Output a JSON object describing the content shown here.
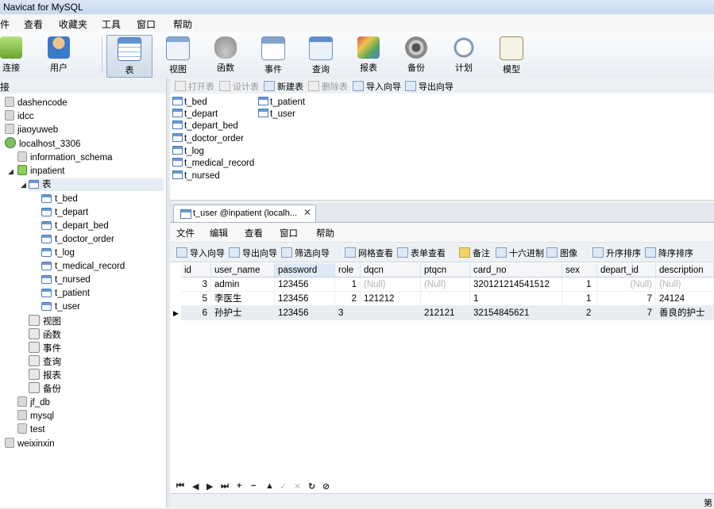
{
  "window": {
    "title": "Navicat for MySQL"
  },
  "menu": [
    "件",
    "查看",
    "收藏夹",
    "工具",
    "窗口",
    "帮助"
  ],
  "toolbar": [
    {
      "label": "连接",
      "icon": "connect-icon"
    },
    {
      "label": "用户",
      "icon": "user-icon"
    },
    {
      "label": "表",
      "icon": "table-icon",
      "active": true
    },
    {
      "label": "视图",
      "icon": "view-icon"
    },
    {
      "label": "函数",
      "icon": "function-icon"
    },
    {
      "label": "事件",
      "icon": "event-icon"
    },
    {
      "label": "查询",
      "icon": "query-icon"
    },
    {
      "label": "报表",
      "icon": "report-icon"
    },
    {
      "label": "备份",
      "icon": "backup-icon"
    },
    {
      "label": "计划",
      "icon": "schedule-icon"
    },
    {
      "label": "模型",
      "icon": "model-icon"
    }
  ],
  "connection_label": "接",
  "tree": {
    "connections": [
      "dashencode",
      "idcc",
      "jiaoyuweb",
      "localhost_3306"
    ],
    "databases_top": [
      "information_schema",
      "inpatient"
    ],
    "tables_folder": "表",
    "tables": [
      "t_bed",
      "t_depart",
      "t_depart_bed",
      "t_doctor_order",
      "t_log",
      "t_medical_record",
      "t_nursed",
      "t_patient",
      "t_user"
    ],
    "folders": [
      "视图",
      "函数",
      "事件",
      "查询",
      "报表",
      "备份"
    ],
    "databases_bottom": [
      "jf_db",
      "mysql",
      "test"
    ],
    "last_connection": "weixinxin"
  },
  "object_toolbar": [
    {
      "label": "打开表",
      "disabled": true
    },
    {
      "label": "设计表",
      "disabled": true
    },
    {
      "label": "新建表",
      "disabled": false
    },
    {
      "label": "删除表",
      "disabled": true
    },
    {
      "label": "导入向导",
      "disabled": false
    },
    {
      "label": "导出向导",
      "disabled": false
    }
  ],
  "objects_col1": [
    "t_bed",
    "t_depart",
    "t_depart_bed",
    "t_doctor_order",
    "t_log",
    "t_medical_record",
    "t_nursed"
  ],
  "objects_col2": [
    "t_patient",
    "t_user"
  ],
  "tab": {
    "title": "t_user @inpatient (localh...",
    "close": "✕"
  },
  "sub_menu": [
    "文件",
    "编辑",
    "查看",
    "窗口",
    "帮助"
  ],
  "sub_toolbar": [
    "导入向导",
    "导出向导",
    "筛选向导",
    "网格查看",
    "表单查看",
    "备注",
    "十六进制",
    "图像",
    "升序排序",
    "降序排序"
  ],
  "grid": {
    "columns": [
      "id",
      "user_name",
      "password",
      "role",
      "dqcn",
      "ptqcn",
      "card_no",
      "sex",
      "depart_id",
      "description"
    ],
    "rows": [
      {
        "id": "3",
        "user_name": "admin",
        "password": "123456",
        "role": "1",
        "dqcn": "(Null)",
        "ptqcn": "(Null)",
        "card_no": "320121214541512",
        "sex": "1",
        "depart_id": "(Null)",
        "description": "(Null)"
      },
      {
        "id": "5",
        "user_name": "李医生",
        "password": "123456",
        "role": "2",
        "dqcn": "121212",
        "ptqcn": "",
        "card_no": "1",
        "sex": "1",
        "depart_id": "7",
        "description": "24124"
      },
      {
        "id": "6",
        "user_name": "孙护士",
        "password": "123456",
        "role": "3",
        "dqcn": "",
        "ptqcn": "212121",
        "card_no": "32154845621",
        "sex": "2",
        "depart_id": "7",
        "description": "善良的护士"
      }
    ]
  },
  "nav_buttons": [
    "⏮",
    "◀",
    "▶",
    "⏭",
    "+",
    "−",
    "▲",
    "✓",
    "✕",
    "↻",
    "⊘"
  ],
  "status_text": "第"
}
